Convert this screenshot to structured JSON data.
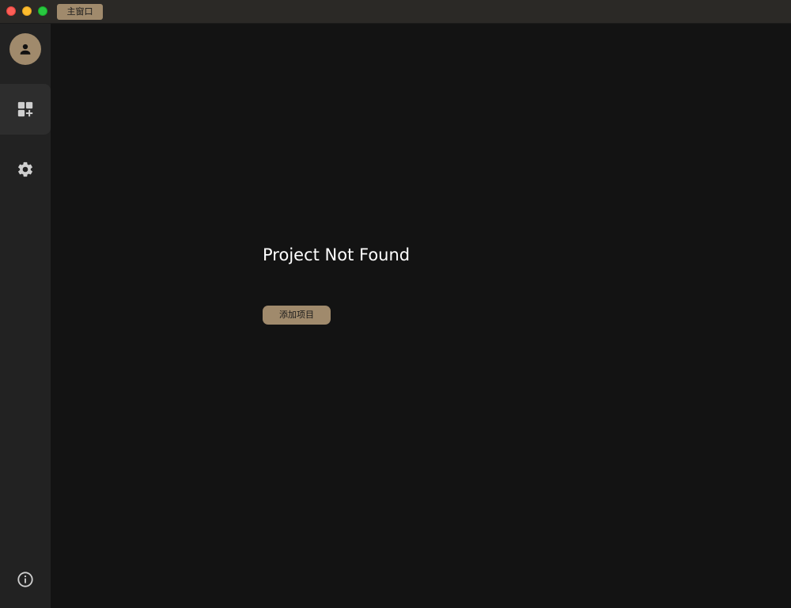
{
  "titlebar": {
    "tab_label": "主窗口"
  },
  "sidebar": {
    "items": [
      {
        "icon": "avatar-icon"
      },
      {
        "icon": "add-project-icon",
        "active": true
      },
      {
        "icon": "gear-icon"
      },
      {
        "icon": "info-icon"
      }
    ]
  },
  "main": {
    "empty_title": "Project Not Found",
    "add_button_label": "添加项目"
  },
  "colors": {
    "accent": "#a08a6c",
    "background": "#131313",
    "sidebar": "#222222",
    "active_item": "#2d2d2d"
  }
}
